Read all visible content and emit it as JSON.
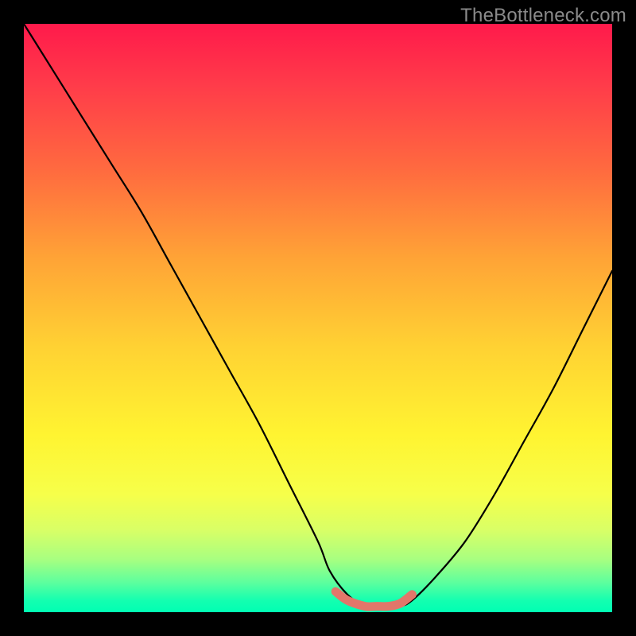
{
  "watermark": "TheBottleneck.com",
  "chart_data": {
    "type": "line",
    "title": "",
    "xlabel": "",
    "ylabel": "",
    "xlim": [
      0,
      100
    ],
    "ylim": [
      0,
      100
    ],
    "grid": false,
    "legend": false,
    "series": [
      {
        "name": "curve",
        "color": "#000000",
        "x": [
          0,
          5,
          10,
          15,
          20,
          25,
          30,
          35,
          40,
          45,
          50,
          52,
          55,
          58,
          60,
          62,
          64,
          66,
          70,
          75,
          80,
          85,
          90,
          95,
          100
        ],
        "y": [
          100,
          92,
          84,
          76,
          68,
          59,
          50,
          41,
          32,
          22,
          12,
          7,
          3,
          1,
          1,
          1,
          1,
          2,
          6,
          12,
          20,
          29,
          38,
          48,
          58
        ]
      }
    ],
    "highlight_segment": {
      "name": "bottom-highlight",
      "color": "#e2766a",
      "thickness": 10,
      "x": [
        53,
        55,
        58,
        60,
        62,
        64,
        66
      ],
      "y": [
        3.5,
        2.0,
        1.0,
        1.0,
        1.0,
        1.5,
        3.0
      ]
    },
    "gradient_stops": [
      {
        "pos": 0.0,
        "color": "#ff1a4b"
      },
      {
        "pos": 0.1,
        "color": "#ff3a4a"
      },
      {
        "pos": 0.25,
        "color": "#ff6b3f"
      },
      {
        "pos": 0.4,
        "color": "#ffa436"
      },
      {
        "pos": 0.55,
        "color": "#ffd233"
      },
      {
        "pos": 0.7,
        "color": "#fff431"
      },
      {
        "pos": 0.8,
        "color": "#f6ff4a"
      },
      {
        "pos": 0.86,
        "color": "#d9ff66"
      },
      {
        "pos": 0.91,
        "color": "#a8ff80"
      },
      {
        "pos": 0.95,
        "color": "#5cff9e"
      },
      {
        "pos": 0.98,
        "color": "#14ffb0"
      },
      {
        "pos": 1.0,
        "color": "#00ffb3"
      }
    ]
  }
}
